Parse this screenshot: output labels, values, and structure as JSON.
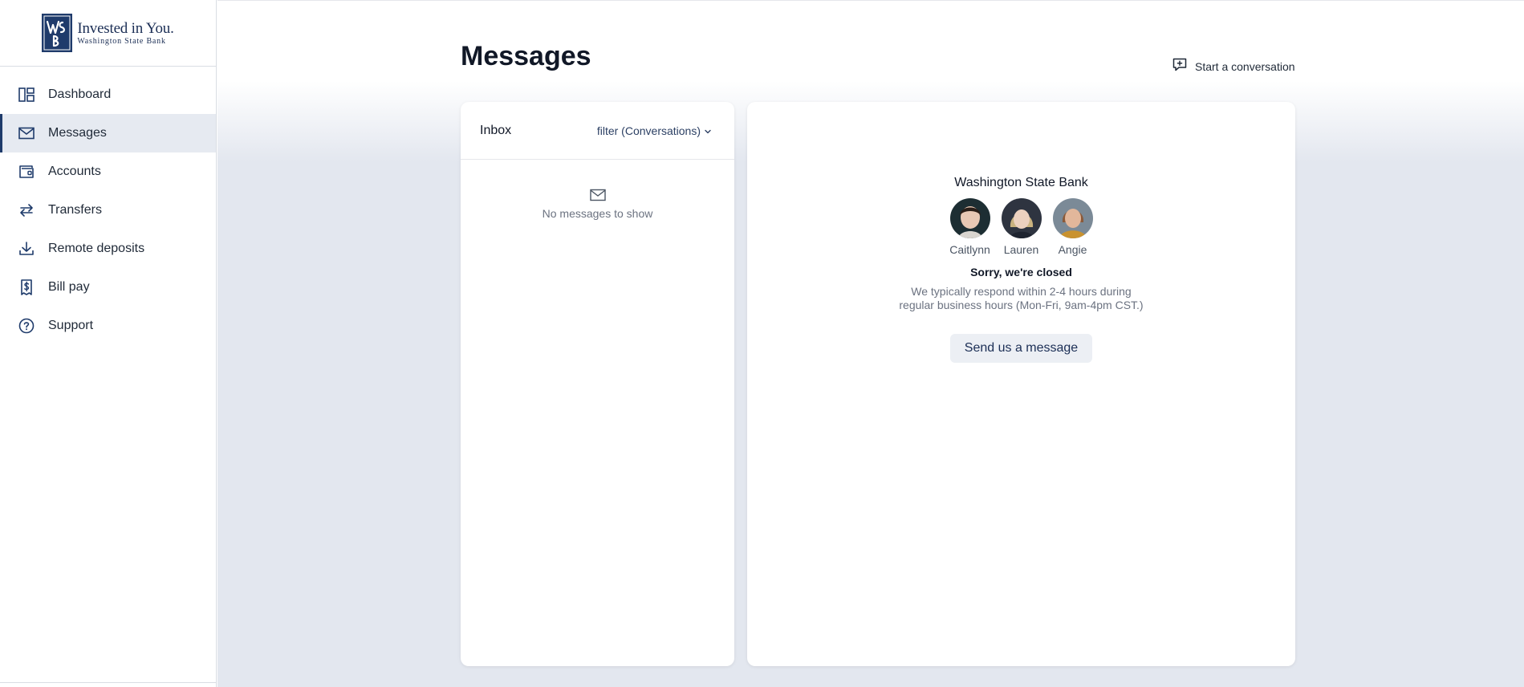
{
  "brand": {
    "tagline": "Invested in You.",
    "bank_name": "Washington State Bank",
    "logo_letters": "WSB",
    "accent_color": "#1f3b6b"
  },
  "sidebar": {
    "items": [
      {
        "label": "Dashboard",
        "icon": "dashboard-icon",
        "active": false
      },
      {
        "label": "Messages",
        "icon": "mail-icon",
        "active": true
      },
      {
        "label": "Accounts",
        "icon": "wallet-icon",
        "active": false
      },
      {
        "label": "Transfers",
        "icon": "transfer-arrows-icon",
        "active": false
      },
      {
        "label": "Remote deposits",
        "icon": "download-icon",
        "active": false
      },
      {
        "label": "Bill pay",
        "icon": "receipt-dollar-icon",
        "active": false
      },
      {
        "label": "Support",
        "icon": "help-circle-icon",
        "active": false
      }
    ]
  },
  "header": {
    "title": "Messages",
    "start_conversation_label": "Start a conversation",
    "start_conversation_icon": "chat-plus-icon"
  },
  "inbox": {
    "title": "Inbox",
    "filter_label": "filter (Conversations)",
    "filter_icon": "chevron-down-icon",
    "empty_icon": "mail-icon",
    "empty_text": "No messages to show"
  },
  "detail": {
    "bank_name": "Washington State Bank",
    "agents": [
      {
        "name": "Caitlynn"
      },
      {
        "name": "Lauren"
      },
      {
        "name": "Angie"
      }
    ],
    "closed_title": "Sorry, we're closed",
    "closed_description": "We typically respond within 2-4 hours during regular business hours (Mon-Fri, 9am-4pm CST.)",
    "send_button_label": "Send us a message"
  }
}
